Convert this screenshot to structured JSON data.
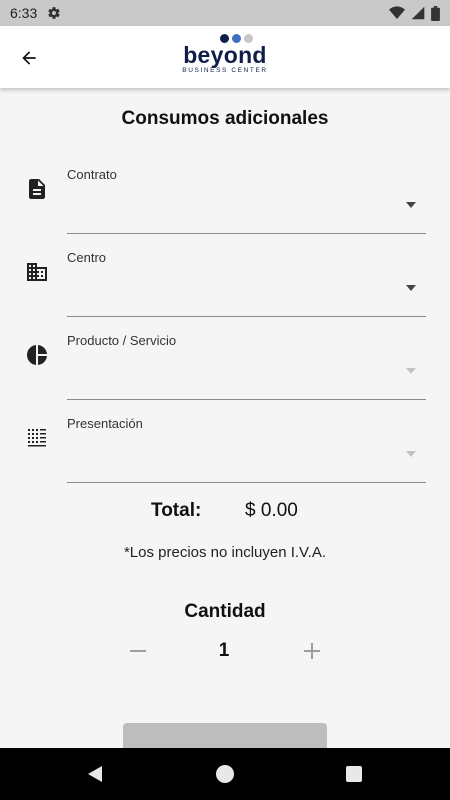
{
  "status_bar": {
    "time": "6:33",
    "icons": [
      "gear-icon",
      "wifi-icon",
      "signal-icon",
      "battery-icon"
    ]
  },
  "app_bar": {
    "back_icon": "arrow-left-icon",
    "logo": {
      "word": "beyond",
      "subtitle": "BUSINESS CENTER",
      "dot_colors": [
        "#0f1f4a",
        "#3d6fbf",
        "#c8c8c8"
      ]
    }
  },
  "page": {
    "title": "Consumos adicionales"
  },
  "form": {
    "fields": [
      {
        "label": "Contrato",
        "value": "",
        "icon": "document-icon",
        "enabled": true
      },
      {
        "label": "Centro",
        "value": "",
        "icon": "building-icon",
        "enabled": true
      },
      {
        "label": "Producto / Servicio",
        "value": "",
        "icon": "pie-chart-icon",
        "enabled": false
      },
      {
        "label": "Presentación",
        "value": "",
        "icon": "grid-list-icon",
        "enabled": false
      }
    ]
  },
  "summary": {
    "total_label": "Total:",
    "total_value": "$ 0.00",
    "note": "*Los precios no incluyen I.V.A."
  },
  "quantity": {
    "title": "Cantidad",
    "value": "1",
    "minus_icon": "minus-icon",
    "plus_icon": "plus-icon"
  },
  "nav_bar": {
    "icons": [
      "nav-back-icon",
      "nav-home-icon",
      "nav-recent-icon"
    ]
  },
  "colors": {
    "brand": "#0f1f4a",
    "brand_accent": "#3d6fbf",
    "background": "#f5f5f5",
    "disabled": "#c2c2c2"
  }
}
